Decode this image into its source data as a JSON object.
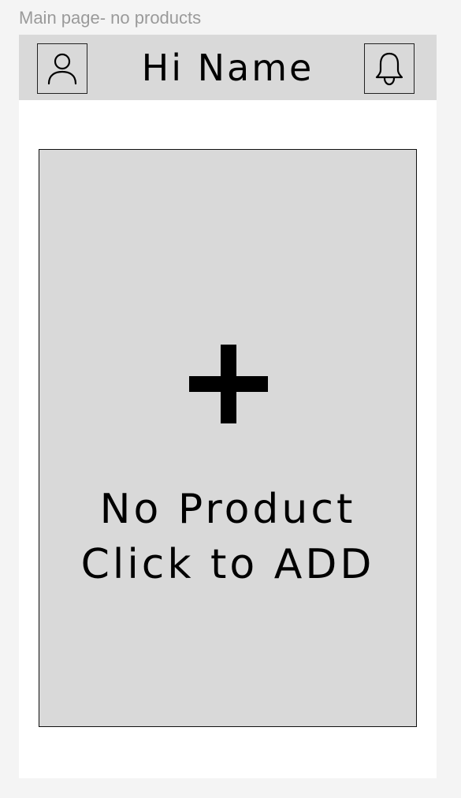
{
  "frame": {
    "label": "Main page- no products"
  },
  "header": {
    "greeting": "Hi Name",
    "profile_icon": "user-icon",
    "notification_icon": "bell-icon"
  },
  "empty_state": {
    "icon": "plus-icon",
    "line1": "No Product",
    "line2": "Click to ADD"
  },
  "colors": {
    "canvas_background": "#f4f4f4",
    "screen_background": "#ffffff",
    "header_background": "#d9d9d9",
    "card_background": "#d9d9d9",
    "text": "#000000",
    "frame_label": "#9a9a9a"
  }
}
